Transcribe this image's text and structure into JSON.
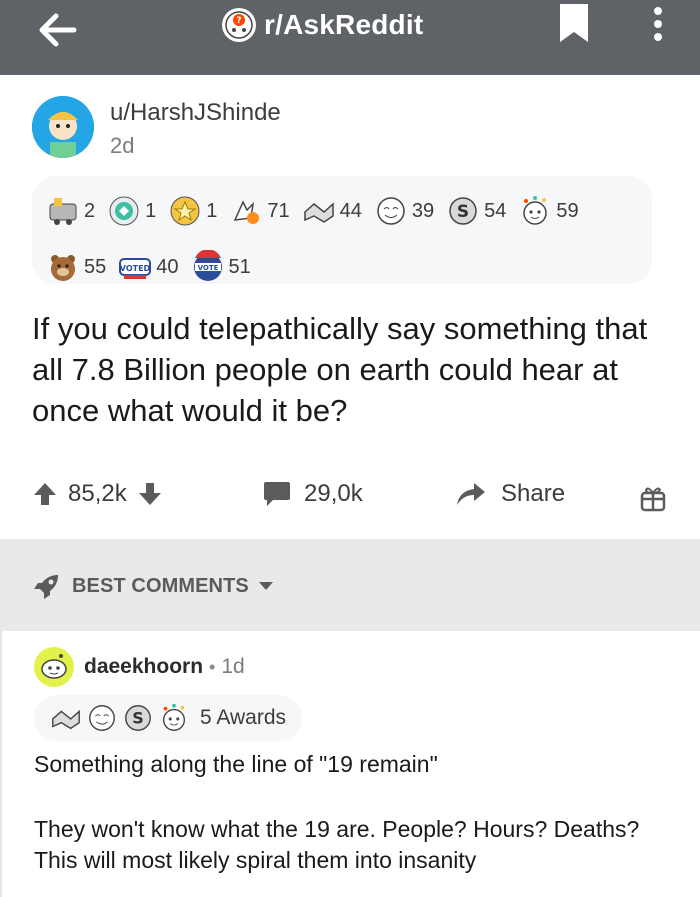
{
  "header": {
    "subreddit": "r/AskReddit",
    "back_icon": "back-arrow-icon",
    "bookmark_icon": "bookmark-icon",
    "more_icon": "more-vertical-icon",
    "bar_color": "#5f6368"
  },
  "post": {
    "author": "u/HarshJShinde",
    "age": "2d",
    "awards_row1": [
      {
        "icon": "train-award-icon",
        "count": "2"
      },
      {
        "icon": "platinum-award-icon",
        "count": "1"
      },
      {
        "icon": "gold-award-icon",
        "count": "1"
      },
      {
        "icon": "hand-fire-award-icon",
        "count": "71"
      },
      {
        "icon": "handshake-award-icon",
        "count": "44"
      },
      {
        "icon": "wholesome-face-award-icon",
        "count": "39"
      },
      {
        "icon": "silver-s-award-icon",
        "count": "54"
      },
      {
        "icon": "party-face-award-icon",
        "count": "59"
      }
    ],
    "awards_row2": [
      {
        "icon": "bear-award-icon",
        "count": "55"
      },
      {
        "icon": "voted-award-icon",
        "count": "40"
      },
      {
        "icon": "vote-award-icon",
        "count": "51"
      }
    ],
    "title": "If you could telepathically say something that all 7.8 Billion people on earth could hear at once what would it be?",
    "score": "85,2k",
    "comments": "29,0k",
    "share": "Share"
  },
  "sort": {
    "label": "BEST COMMENTS"
  },
  "comment": {
    "author": "daeekhoorn",
    "dot": "•",
    "age": "1d",
    "awards_label": "5 Awards",
    "paragraphs": [
      "Something along the line of \"19 remain\"",
      "They won't know what the 19 are. People? Hours? Deaths? This will most likely spiral them into insanity"
    ]
  },
  "colors": {
    "gray_text": "#3c3c3e",
    "sort_bg": "#e9e9ea",
    "award_bg": "#f6f7f8"
  }
}
